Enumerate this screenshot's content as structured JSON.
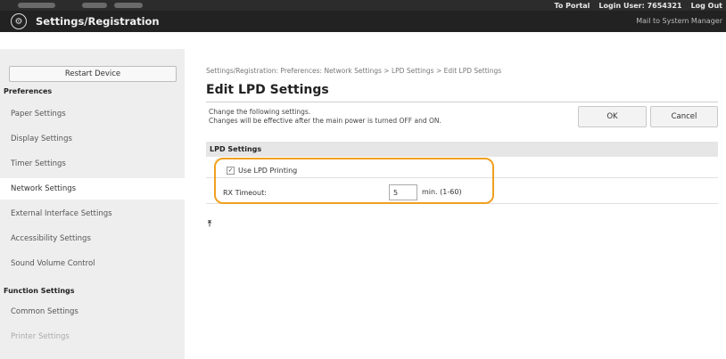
{
  "topbar": {
    "to_portal": "To Portal",
    "login_user_label": "Login User:",
    "login_user_value": "7654321",
    "logout": "Log Out",
    "mail_link": "Mail to System Manager",
    "app_title": "Settings/Registration",
    "logo_icon": "settings-gear-icon"
  },
  "sidebar": {
    "restart_label": "Restart Device",
    "preferences_heading": "Preferences",
    "items": [
      {
        "label": "Paper Settings"
      },
      {
        "label": "Display Settings"
      },
      {
        "label": "Timer Settings"
      },
      {
        "label": "Network Settings"
      },
      {
        "label": "External Interface Settings"
      },
      {
        "label": "Accessibility Settings"
      },
      {
        "label": "Sound Volume Control"
      }
    ],
    "function_heading": "Function Settings",
    "function_items": [
      {
        "label": "Common Settings"
      },
      {
        "label": "Printer Settings"
      }
    ]
  },
  "main": {
    "breadcrumb": "Settings/Registration: Preferences: Network Settings > LPD Settings > Edit LPD Settings",
    "title": "Edit LPD Settings",
    "desc_line1": "Change the following settings.",
    "desc_line2": "Changes will be effective after the main power is turned OFF and ON.",
    "ok_label": "OK",
    "cancel_label": "Cancel",
    "section_title": "LPD Settings",
    "use_lpd_label": "Use LPD Printing",
    "use_lpd_checked": true,
    "rx_label": "RX Timeout:",
    "rx_value": "5",
    "rx_unit": "min. (1-60)",
    "back_to_top_icon": "arrow-up-to-top-icon"
  },
  "colors": {
    "topbar_bg": "#222222",
    "sidebar_bg": "#eeeeee",
    "highlight": "#f0a020"
  }
}
